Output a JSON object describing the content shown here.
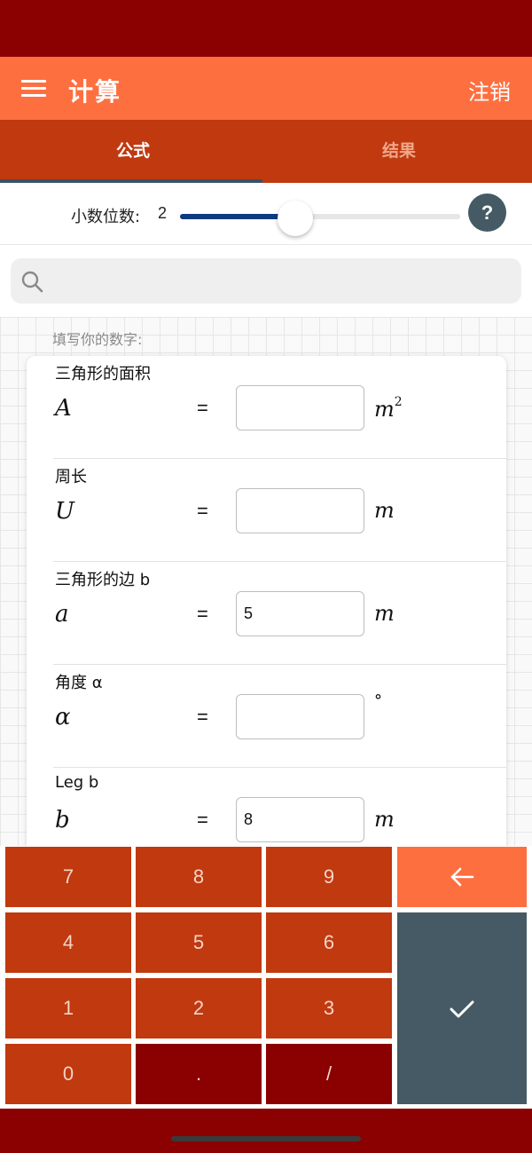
{
  "app_bar": {
    "title": "计算",
    "logout_label": "注销"
  },
  "tabs": [
    {
      "label": "公式"
    },
    {
      "label": "结果"
    }
  ],
  "decimals": {
    "label": "小数位数:",
    "value": "2",
    "slider_level": 0.41,
    "help_label": "?"
  },
  "search": {
    "placeholder": ""
  },
  "form": {
    "prompt": "填写你的数字:",
    "fields": [
      {
        "title": "三角形的面积",
        "symbol": "A",
        "value": "",
        "unit": "m",
        "unit_exp": "2"
      },
      {
        "title": "周长",
        "symbol": "U",
        "value": "",
        "unit": "m",
        "unit_exp": ""
      },
      {
        "title": "三角形的边 b",
        "symbol": "a",
        "value": "5",
        "unit": "m",
        "unit_exp": ""
      },
      {
        "title": "角度 α",
        "symbol": "α",
        "value": "",
        "unit": "°",
        "unit_exp": ""
      },
      {
        "title": "Leg b",
        "symbol": "b",
        "value": "8",
        "unit": "m",
        "unit_exp": ""
      }
    ]
  },
  "keypad": {
    "keys": [
      "7",
      "8",
      "9",
      "4",
      "5",
      "6",
      "1",
      "2",
      "3",
      "0",
      ".",
      "/"
    ],
    "backspace_icon": "arrow-left-icon",
    "confirm_icon": "check-icon"
  }
}
